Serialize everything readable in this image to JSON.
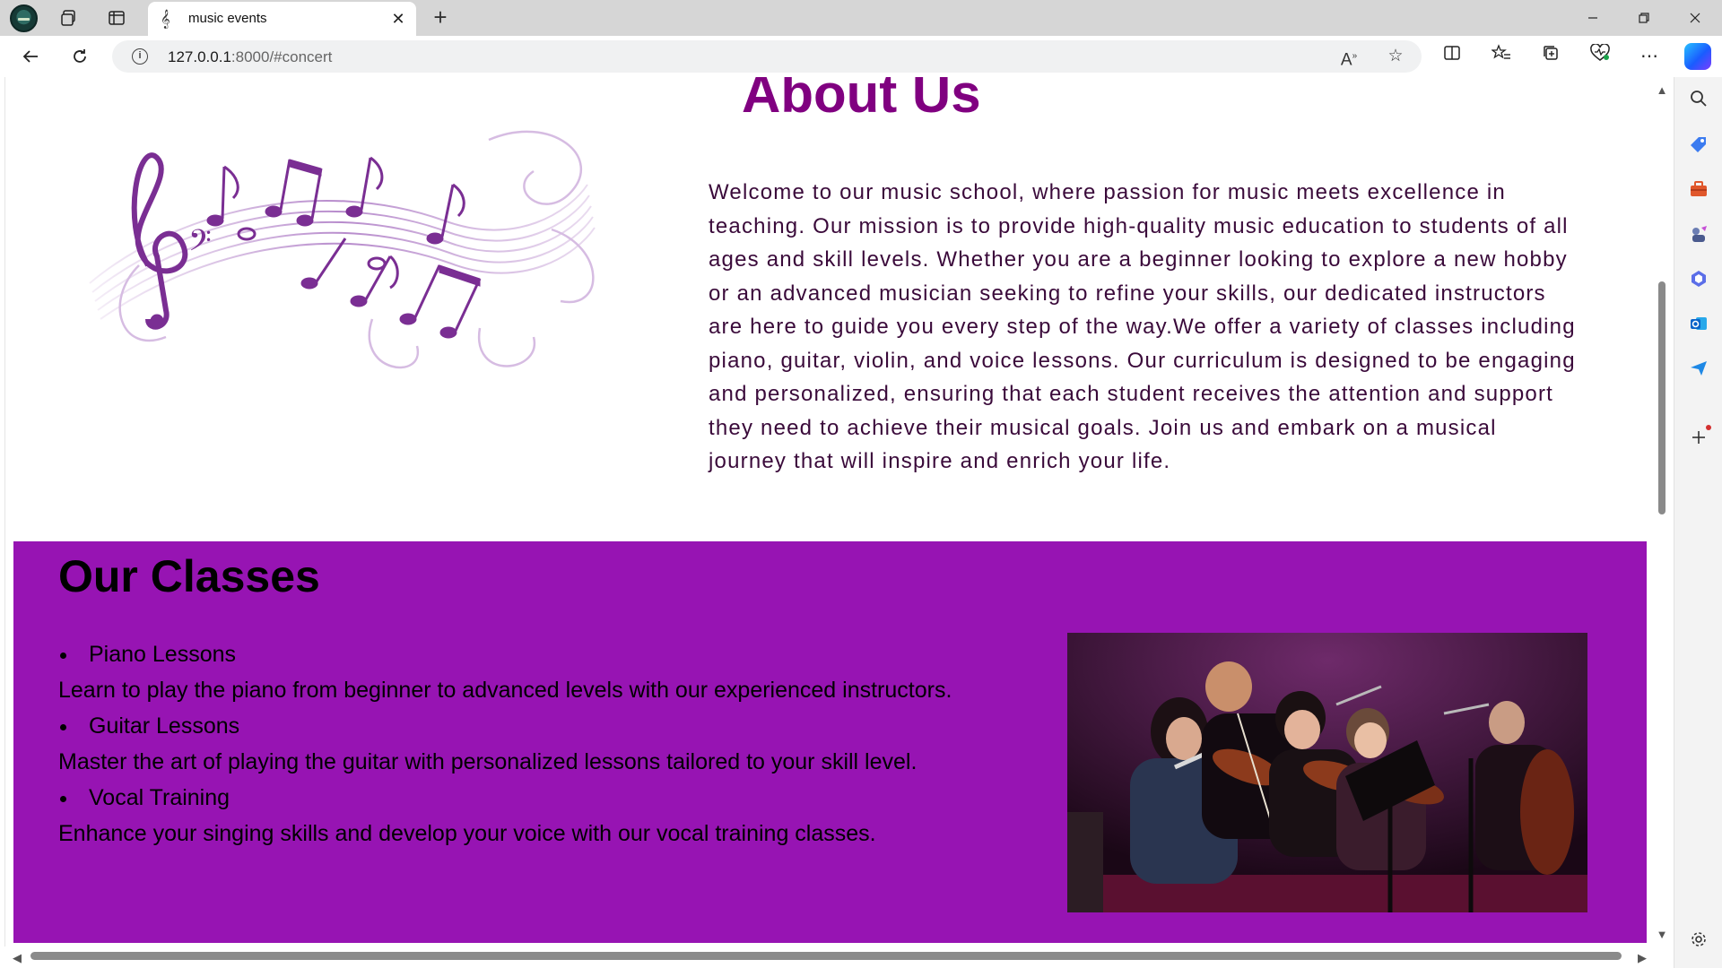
{
  "browser": {
    "tab": {
      "title": "music events",
      "favicon": "music-note-favicon"
    },
    "url": {
      "host": "127.0.0.1",
      "path": ":8000/#concert"
    }
  },
  "page": {
    "about": {
      "title": "About Us",
      "text": "Welcome to our music school, where passion for music meets excellence in teaching. Our mission is to provide high-quality music education to students of all ages and skill levels. Whether you are a beginner looking to explore a new hobby or an advanced musician seeking to refine your skills, our dedicated instructors are here to guide you every step of the way.We offer a variety of classes including piano, guitar, violin, and voice lessons. Our curriculum is designed to be engaging and personalized, ensuring that each student receives the attention and support they need to achieve their musical goals. Join us and embark on a musical journey that will inspire and enrich your life."
    },
    "classes": {
      "title": "Our Classes",
      "items": [
        {
          "name": "Piano Lessons",
          "description": "Learn to play the piano from beginner to advanced levels with our experienced instructors."
        },
        {
          "name": "Guitar Lessons",
          "description": "Master the art of playing the guitar with personalized lessons tailored to your skill level."
        },
        {
          "name": "Vocal Training",
          "description": "Enhance your singing skills and develop your voice with our vocal training classes."
        }
      ]
    }
  },
  "colors": {
    "about_title": "#800080",
    "classes_background": "#9714b3",
    "about_text": "#3a0a3a"
  }
}
